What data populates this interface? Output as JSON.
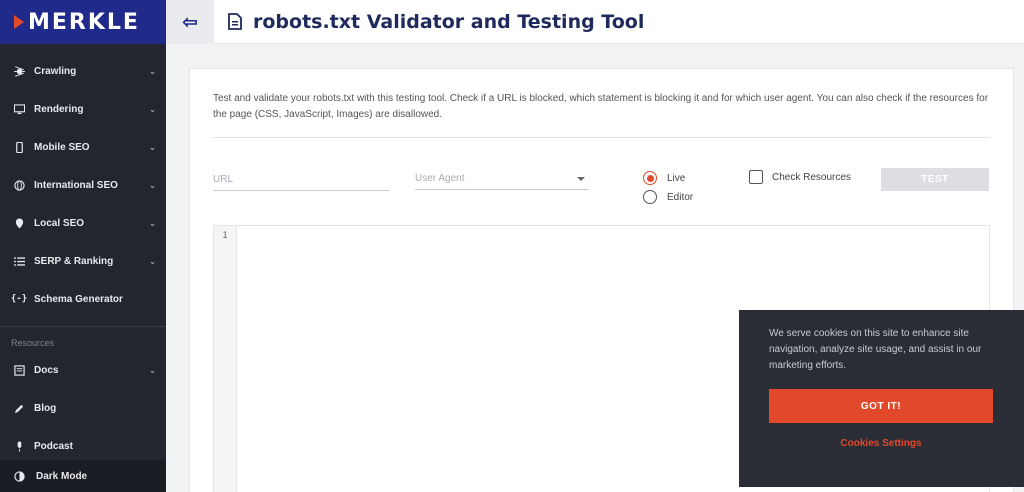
{
  "brand": {
    "logo_text": "MERKLE",
    "accent": "#e2492b",
    "primary": "#1f2a8a"
  },
  "header": {
    "title": "robots.txt Validator and Testing Tool",
    "toggle_icon": "collapse-arrow-icon"
  },
  "sidebar": {
    "items": [
      {
        "label": "Crawling",
        "icon": "spider-icon"
      },
      {
        "label": "Rendering",
        "icon": "monitor-icon"
      },
      {
        "label": "Mobile SEO",
        "icon": "phone-icon"
      },
      {
        "label": "International SEO",
        "icon": "globe-icon"
      },
      {
        "label": "Local SEO",
        "icon": "pin-icon"
      },
      {
        "label": "SERP & Ranking",
        "icon": "list-icon"
      },
      {
        "label": "Schema Generator",
        "icon": "braces-icon"
      }
    ],
    "resources_label": "Resources",
    "resources": [
      {
        "label": "Docs",
        "icon": "docs-icon"
      },
      {
        "label": "Blog",
        "icon": "pencil-icon"
      },
      {
        "label": "Podcast",
        "icon": "mic-icon"
      }
    ],
    "dark_mode_label": "Dark Mode"
  },
  "main": {
    "description": "Test and validate your robots.txt with this testing tool. Check if a URL is blocked, which statement is blocking it and for which user agent. You can also check if the resources for the page (CSS, JavaScript, Images) are disallowed.",
    "url_placeholder": "URL",
    "user_agent_placeholder": "User Agent",
    "radio_live": "Live",
    "radio_editor": "Editor",
    "selected_mode": "Live",
    "check_resources_label": "Check Resources",
    "test_button": "TEST",
    "editor_line": "1"
  },
  "cookie": {
    "text": "We serve cookies on this site to enhance site navigation, analyze site usage, and assist in our marketing efforts.",
    "accept": "GOT IT!",
    "settings": "Cookies Settings"
  }
}
